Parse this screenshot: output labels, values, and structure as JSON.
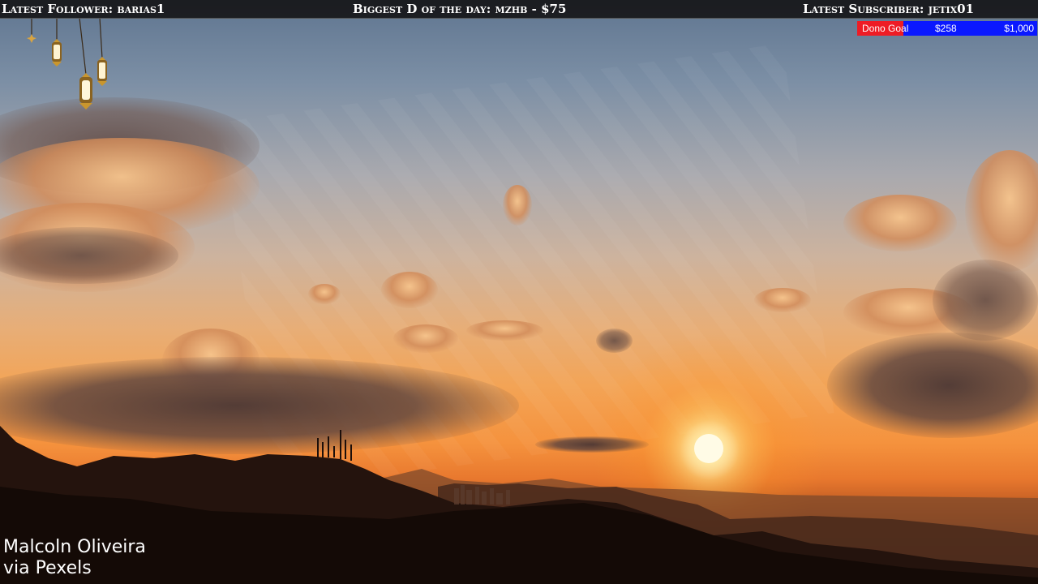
{
  "topbar": {
    "latest_follower": "Latest Follower: barias1",
    "biggest_donation": "Biggest D of the day: mzhb - $75",
    "latest_subscriber": "Latest Subscriber: jetix01"
  },
  "donation_goal": {
    "label": "Dono Goal",
    "current": "$258",
    "target": "$1,000",
    "progress": 0.258,
    "fill_color": "#ee1c25",
    "bar_color": "#0a18ff"
  },
  "credit": {
    "author": "Malcoln Oliveira",
    "source": "via Pexels"
  },
  "decorations": {
    "icon": "lantern-icon"
  }
}
